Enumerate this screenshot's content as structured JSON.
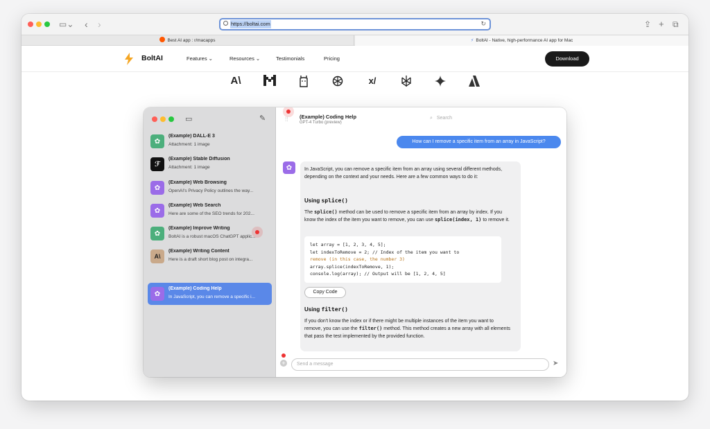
{
  "browser": {
    "url": "https://boltai.com",
    "tabs": [
      {
        "label": "Best AI app : r/macapps",
        "active": false
      },
      {
        "label": "BoltAI - Native, high-performance AI app for Mac",
        "active": true
      }
    ],
    "traffic_colors": [
      "#ff5f57",
      "#febc2e",
      "#28c840"
    ]
  },
  "site": {
    "brand": "BoltAI",
    "nav": [
      "Features ⌄",
      "Resources ⌄",
      "Testimonials",
      "Pricing"
    ],
    "download_label": "Download",
    "provider_logos": [
      "anthropic-logo",
      "mistral-logo",
      "ollama-logo",
      "openai-logo",
      "xai-logo",
      "perplexity-logo",
      "gemini-logo",
      "azure-logo"
    ]
  },
  "app": {
    "chats": [
      {
        "title": "(Example) DALL-E 3",
        "subtitle": "Attachment: 1 image",
        "icon": "openai-icon",
        "color": "#4caf7c",
        "glyph": "✿"
      },
      {
        "title": "(Example) Stable Diffusion",
        "subtitle": "Attachment: 1 image",
        "icon": "stability-icon",
        "color": "#111111",
        "glyph": "ℱ"
      },
      {
        "title": "(Example) Web Browsing",
        "subtitle": "OpenAI's Privacy Policy outlines the way...",
        "icon": "openai-icon",
        "color": "#9b6ce8",
        "glyph": "✿"
      },
      {
        "title": "(Example) Web Search",
        "subtitle": "Here are some of the SEO trends for 202...",
        "icon": "openai-icon",
        "color": "#9b6ce8",
        "glyph": "✿"
      },
      {
        "title": "(Example) Improve Writing",
        "subtitle": "BoltAI is a robust macOS ChatGPT applic...",
        "icon": "openai-icon",
        "color": "#4caf7c",
        "glyph": "✿"
      },
      {
        "title": "(Example) Writing Content",
        "subtitle": "Here is a draft short blog post on integra...",
        "icon": "anthropic-icon",
        "color": "#c9a98a",
        "glyph": "A\\"
      },
      {
        "title": "(Example) Coding Help",
        "subtitle": "In JavaScript, you can remove a specific i...",
        "icon": "openai-icon",
        "color": "#9b6ce8",
        "glyph": "✿",
        "selected": true
      }
    ],
    "conversation": {
      "title": "(Example) Coding Help",
      "model": "GPT-4 Turbo (preview)",
      "search_placeholder": "Search",
      "user_message": "How can I remove a specific item from an array in JavaScript?",
      "intro": "In JavaScript, you can remove a specific item from an array using several different methods, depending on the context and your needs. Here are a few common ways to do it:",
      "heading1_pre": "Using ",
      "heading1_code": "splice()",
      "p1_a": "The ",
      "p1_code1": "splice()",
      "p1_b": " method can be used to remove a specific item from an array by index. If you know the index of the item you want to remove, you can use ",
      "p1_code2": "splice(index, 1)",
      "p1_c": " to remove it.",
      "code_lines": [
        "let array = [1, 2, 3, 4, 5];",
        "let indexToRemove = 2; // Index of the item you want to",
        "remove (in this case, the number 3)",
        "array.splice(indexToRemove, 1);",
        "console.log(array); // Output will be [1, 2, 4, 5]"
      ],
      "copy_label": "Copy Code",
      "heading2_pre": "Using ",
      "heading2_code": "filter()",
      "p2_a": "If you don't know the index or if there might be multiple instances of the item you want to remove, you can use the ",
      "p2_code": "filter()",
      "p2_b": " method. This method creates a new array with all elements that pass the test implemented by the provided function.",
      "input_placeholder": "Send a message"
    }
  }
}
